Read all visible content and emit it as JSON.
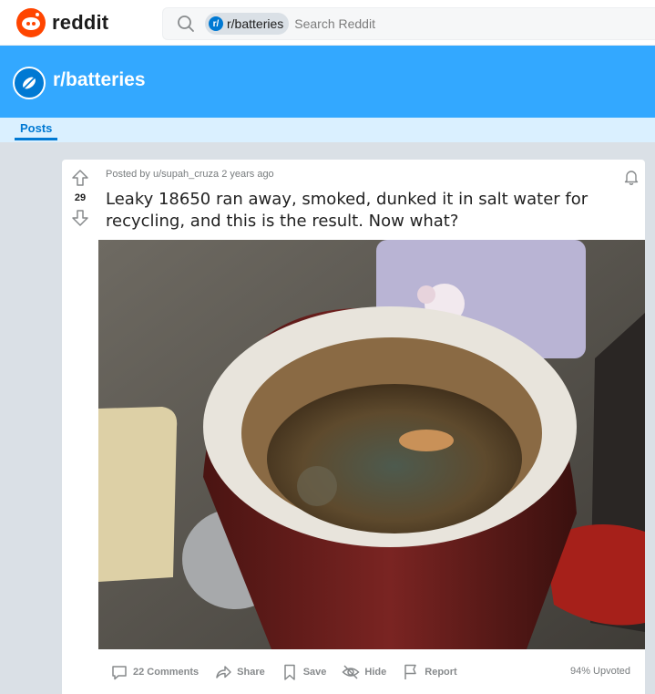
{
  "header": {
    "logo_text": "reddit",
    "search_chip": "r/batteries",
    "search_placeholder": "Search Reddit"
  },
  "subreddit": {
    "name": "r/batteries",
    "banner_color": "#33a8ff",
    "icon_color": "#0079d3"
  },
  "tabs": [
    {
      "label": "Posts",
      "active": true
    }
  ],
  "post": {
    "meta": "Posted by u/supah_cruza 2 years ago",
    "score": "29",
    "title": "Leaky 18650 ran away, smoked, dunked it in salt water for recycling, and this is the result. Now what?",
    "image_icon": "photo-of-cup-with-battery-in-salt-water",
    "actions": {
      "comments": "22 Comments",
      "share": "Share",
      "save": "Save",
      "hide": "Hide",
      "report": "Report"
    },
    "upvoted": "94% Upvoted"
  },
  "colors": {
    "accent": "#0079d3",
    "brand": "#ff4500",
    "page_bg": "#dae0e6",
    "tab_bg": "#daf0ff"
  }
}
